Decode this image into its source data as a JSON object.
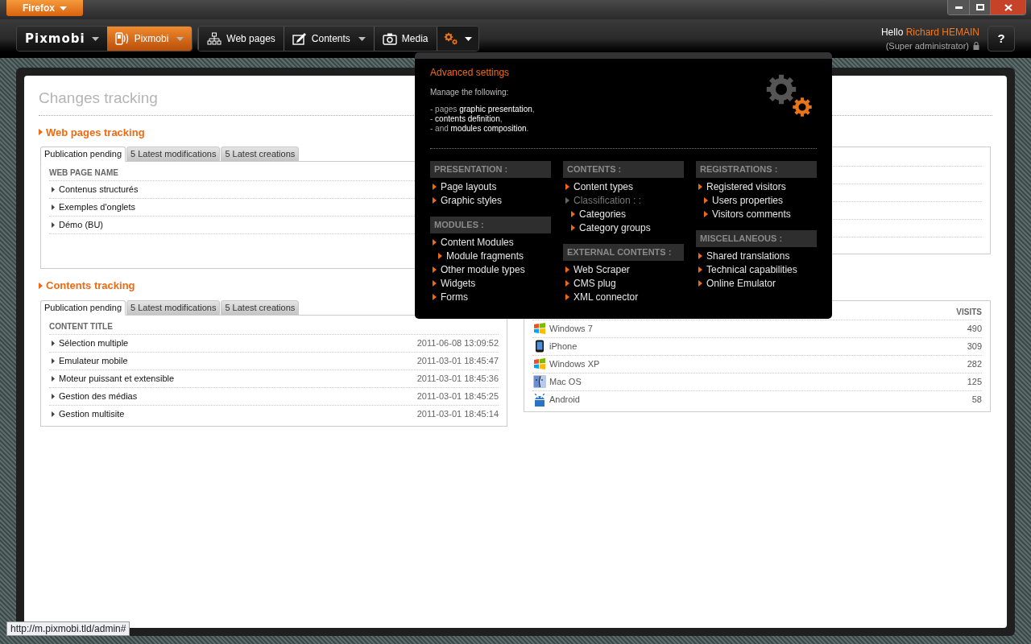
{
  "browser": {
    "menu_button": "Firefox",
    "status_url": "http://m.pixmobi.tld/admin#"
  },
  "nav": {
    "brand": "Pixmobi",
    "items": [
      {
        "label": "Pixmobi",
        "kind": "phone",
        "selected": true,
        "dropdown": true
      },
      {
        "label": "Web pages",
        "kind": "sitemap",
        "selected": false,
        "dropdown": false
      },
      {
        "label": "Contents",
        "kind": "edit",
        "selected": false,
        "dropdown": true
      },
      {
        "label": "Media",
        "kind": "camera",
        "selected": false,
        "dropdown": false
      }
    ],
    "settings_menu": {
      "expanded": true
    }
  },
  "user": {
    "greeting": "Hello",
    "name": "Richard HEMAIN",
    "role": "(Super administrator)",
    "help": "?"
  },
  "page": {
    "title": "Changes tracking",
    "sections": [
      {
        "title": "Web pages tracking",
        "tabs": [
          {
            "label": "Publication pending",
            "selected": true
          },
          {
            "label": "5 Latest modifications",
            "selected": false
          },
          {
            "label": "5 Latest creations",
            "selected": false
          }
        ],
        "left": {
          "header": "WEB PAGE NAME",
          "rows": [
            {
              "title": "Contenus structurés"
            },
            {
              "title": "Exemples d'onglets"
            },
            {
              "title": "Démo (BU)"
            }
          ]
        }
      },
      {
        "title": "Contents tracking",
        "tabs": [
          {
            "label": "Publication pending",
            "selected": true
          },
          {
            "label": "5 Latest modifications",
            "selected": false
          },
          {
            "label": "5 Latest creations",
            "selected": false
          }
        ],
        "left": {
          "header": "CONTENT TITLE",
          "rows": [
            {
              "title": "Sélection multiple",
              "date": "2011-06-08 13:09:52"
            },
            {
              "title": "Emulateur mobile",
              "date": "2011-03-01 18:45:47"
            },
            {
              "title": "Moteur puissant et extensible",
              "date": "2011-03-01 18:45:36"
            },
            {
              "title": "Gestion des médias",
              "date": "2011-03-01 18:45:25"
            },
            {
              "title": "Gestion multisite",
              "date": "2011-03-01 18:45:14"
            }
          ]
        },
        "right": {
          "header_right": "VISITS",
          "rows": [
            {
              "kind": "windows",
              "name": "Windows 7",
              "visits": "490"
            },
            {
              "kind": "phone",
              "name": "iPhone",
              "visits": "309"
            },
            {
              "kind": "windows",
              "name": "Windows XP",
              "visits": "282"
            },
            {
              "kind": "finder",
              "name": "Mac OS",
              "visits": "125"
            },
            {
              "kind": "robot",
              "name": "Android",
              "visits": "58"
            }
          ]
        }
      }
    ]
  },
  "dropdown": {
    "title": "Advanced settings",
    "intro": "Manage the following:",
    "lines": [
      "- pages **graphic presentation**,",
      "- **contents definition**,",
      "- and **modules composition**."
    ],
    "columns": [
      [
        {
          "title": "PRESENTATION :",
          "items": [
            {
              "label": "Page layouts",
              "disabled": false
            },
            {
              "label": "Graphic styles",
              "disabled": false
            }
          ]
        },
        {
          "title": "MODULES :",
          "items": [
            {
              "label": "Content Modules",
              "disabled": false,
              "children": [
                {
                  "label": "Module fragments",
                  "disabled": false
                }
              ]
            },
            {
              "label": "Other module types",
              "disabled": false
            },
            {
              "label": "Widgets",
              "disabled": false
            },
            {
              "label": "Forms",
              "disabled": false
            }
          ]
        }
      ],
      [
        {
          "title": "CONTENTS :",
          "items": [
            {
              "label": "Content types",
              "disabled": false
            },
            {
              "label": "Classification : :",
              "disabled": true,
              "children": [
                {
                  "label": "Categories",
                  "disabled": false
                },
                {
                  "label": "Category groups",
                  "disabled": false
                }
              ]
            }
          ]
        },
        {
          "title": "EXTERNAL CONTENTS :",
          "items": [
            {
              "label": "Web Scraper",
              "disabled": false
            },
            {
              "label": "CMS plug",
              "disabled": false
            },
            {
              "label": "XML connector",
              "disabled": false
            }
          ]
        }
      ],
      [
        {
          "title": "REGISTRATIONS :",
          "items": [
            {
              "label": "Registered visitors",
              "disabled": false,
              "children": [
                {
                  "label": "Users properties",
                  "disabled": false
                },
                {
                  "label": "Visitors comments",
                  "disabled": false
                }
              ]
            }
          ]
        },
        {
          "title": "MISCELLANEOUS :",
          "items": [
            {
              "label": "Shared translations",
              "disabled": false
            },
            {
              "label": "Technical capabilities",
              "disabled": false
            },
            {
              "label": "Online Emulator",
              "disabled": false
            }
          ]
        }
      ]
    ]
  }
}
